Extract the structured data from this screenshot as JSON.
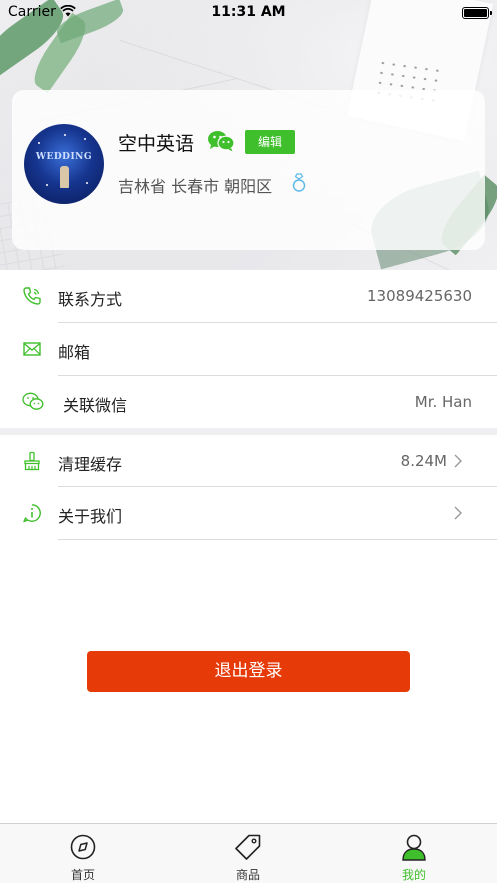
{
  "status_bar": {
    "carrier": "Carrier",
    "time": "11:31 AM"
  },
  "profile": {
    "avatar_text": "WEDDING",
    "name": "空中英语",
    "edit_label": "编辑",
    "location": "吉林省 长春市 朝阳区",
    "wechat_icon": "wechat-icon",
    "ring_icon": "ring-icon"
  },
  "info_rows": [
    {
      "icon": "phone-icon",
      "label": "联系方式",
      "value": "13089425630"
    },
    {
      "icon": "mail-icon",
      "label": "邮箱",
      "value": ""
    },
    {
      "icon": "wechat-icon",
      "label": "关联微信",
      "value": "Mr. Han"
    }
  ],
  "action_rows": [
    {
      "icon": "brush-icon",
      "label": "清理缓存",
      "value": "8.24M"
    },
    {
      "icon": "info-icon",
      "label": "关于我们",
      "value": ""
    }
  ],
  "logout_label": "退出登录",
  "tabs": [
    {
      "icon": "compass-icon",
      "label": "首页",
      "active": false
    },
    {
      "icon": "tag-icon",
      "label": "商品",
      "active": false
    },
    {
      "icon": "user-icon",
      "label": "我的",
      "active": true
    }
  ],
  "colors": {
    "accent_green": "#3fbf2b",
    "logout_red": "#e63a08",
    "icon_green": "#3fbf2b"
  }
}
